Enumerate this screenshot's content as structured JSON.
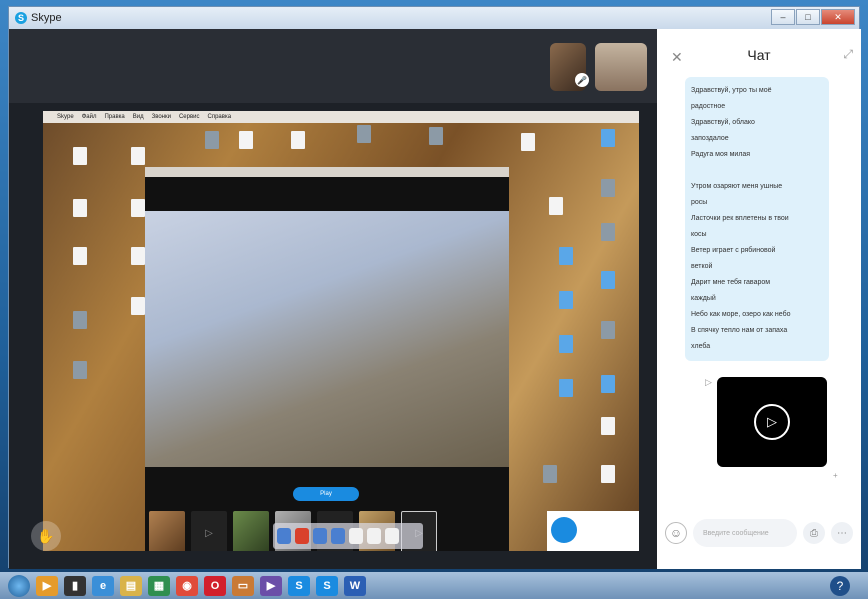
{
  "window": {
    "title": "Skype",
    "controls": [
      "minimize",
      "maximize",
      "close"
    ]
  },
  "call": {
    "shared_screen": {
      "menu_items": [
        "Skype",
        "Файл",
        "Правка",
        "Вид",
        "Звонки",
        "Сервис",
        "Справка"
      ],
      "player_button": "Play"
    }
  },
  "chat": {
    "title": "Чат",
    "messages": [
      "Здравствуй, утро ты моё",
      "радостное",
      "Здравствуй, облако",
      "запоздалое",
      "Радуга моя милая",
      "",
      "Утром озаряют меня ушные",
      "росы",
      "Ласточки рек вплетены в твои",
      "косы",
      "Ветер играет с рябиновой",
      "веткой",
      "Дарит мне тебя гаваром",
      "каждый",
      "Небо как море, озеро как небо",
      "В спячку тепло нам от запаха",
      "хлеба"
    ],
    "composer_placeholder": "Введите сообщение"
  },
  "taskbar": {
    "apps": [
      "media-player",
      "phone",
      "explorer",
      "folder",
      "spreadsheet",
      "chrome",
      "opera",
      "archive",
      "media",
      "skype",
      "skype",
      "word"
    ]
  },
  "colors": {
    "skype_blue": "#1a8be0",
    "chat_bubble": "#dff1fb",
    "call_bg": "#1d2127"
  }
}
